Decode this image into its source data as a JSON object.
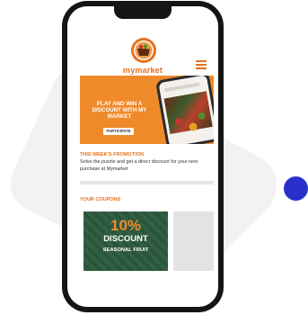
{
  "app": {
    "brand_name": "mymarket",
    "brand_color": "#e8711d"
  },
  "header": {
    "logo_icon": "basket-icon",
    "menu_icon": "hamburger-menu-icon"
  },
  "banner": {
    "headline": "PLAY AND WIN A DISCOUNT WITH MY MARKET",
    "button_label": "PARTICIPATE",
    "background_color": "#ef8a2b"
  },
  "promotion": {
    "title": "THIS WEEK'S PROMOTION",
    "description": "Solve the puzzle and get a direct discount for your next purchase at Mymarket"
  },
  "coupons": {
    "title": "YOUR COUPONS",
    "items": [
      {
        "percent": "10%",
        "label": "DISCOUNT",
        "category": "SEASONAL FRUIT",
        "background_color": "#2b5a3d"
      }
    ]
  },
  "decor": {
    "accent_dot_color": "#2731c9"
  }
}
